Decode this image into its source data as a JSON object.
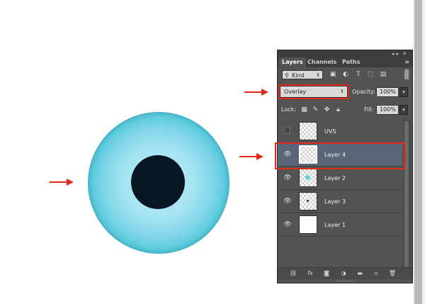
{
  "panel": {
    "topbar_icons": "◂◂ ✕",
    "tabs": [
      {
        "label": "Layers",
        "active": true
      },
      {
        "label": "Channels",
        "active": false
      },
      {
        "label": "Paths",
        "active": false
      }
    ],
    "menu_icon": "hamburger-menu-icon"
  },
  "filter": {
    "kind_label": "Kind",
    "icons": [
      "image-filter-icon",
      "adjustment-filter-icon",
      "type-filter-icon",
      "shape-filter-icon",
      "smart-object-filter-icon"
    ]
  },
  "blend": {
    "mode": "Overlay",
    "opacity_label": "Opacity:",
    "opacity_value": "100%"
  },
  "lock": {
    "label": "Lock:",
    "icons": [
      "lock-transparent-pixels-icon",
      "lock-image-pixels-icon",
      "lock-position-icon",
      "lock-all-icon"
    ],
    "fill_label": "Fill:",
    "fill_value": "100%"
  },
  "layers": [
    {
      "name": "UVS",
      "visible": false,
      "selected": false,
      "thumb": "transparent"
    },
    {
      "name": "Layer 4",
      "visible": true,
      "selected": true,
      "thumb": "transparent"
    },
    {
      "name": "Layer 2",
      "visible": true,
      "selected": false,
      "thumb": "transparent-blue-dot"
    },
    {
      "name": "Layer 3",
      "visible": true,
      "selected": false,
      "thumb": "transparent-dot"
    },
    {
      "name": "Layer 1",
      "visible": true,
      "selected": false,
      "thumb": "white"
    }
  ],
  "bottom_icons": [
    "link-layers-icon",
    "fx-icon",
    "add-mask-icon",
    "adjustment-layer-icon",
    "new-group-icon",
    "new-layer-icon",
    "delete-layer-icon"
  ],
  "colors": {
    "annotation_red": "#e02b1b",
    "iris_teal": "#2ab3c2",
    "pupil": "#071620",
    "panel_bg": "#535353",
    "selected_layer": "#5a6577"
  }
}
